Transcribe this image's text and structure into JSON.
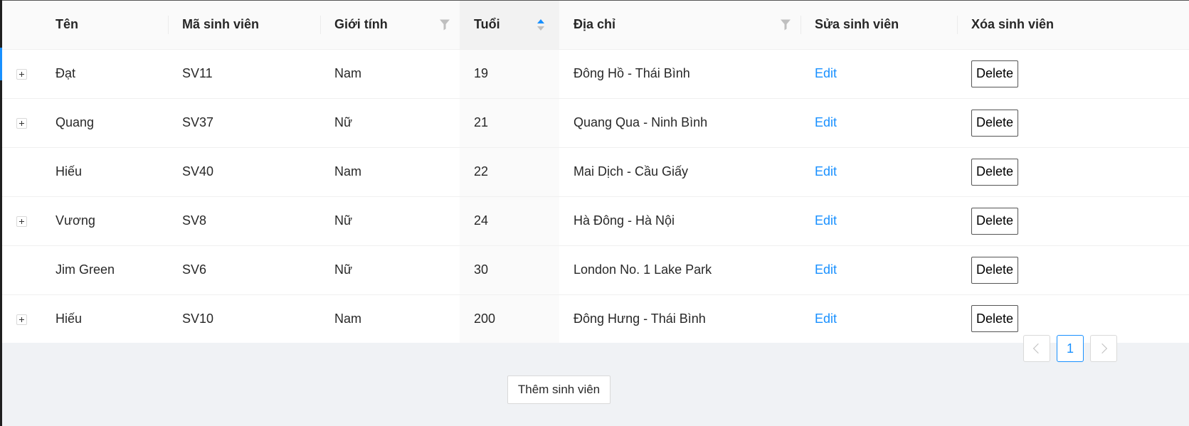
{
  "table": {
    "columns": {
      "name": "Tên",
      "student_id": "Mã sinh viên",
      "gender": "Giới tính",
      "age": "Tuổi",
      "address": "Địa chỉ",
      "edit": "Sửa sinh viên",
      "delete": "Xóa sinh viên"
    },
    "sorted_column": "age",
    "sort_order": "ascend",
    "filter_columns": [
      "gender",
      "address"
    ],
    "rows": [
      {
        "expandable": true,
        "name": "Đạt",
        "student_id": "SV11",
        "gender": "Nam",
        "age": "19",
        "address": "Đông Hồ - Thái Bình",
        "edit_label": "Edit",
        "delete_label": "Delete"
      },
      {
        "expandable": true,
        "name": "Quang",
        "student_id": "SV37",
        "gender": "Nữ",
        "age": "21",
        "address": "Quang Qua - Ninh Bình",
        "edit_label": "Edit",
        "delete_label": "Delete"
      },
      {
        "expandable": false,
        "name": "Hiếu",
        "student_id": "SV40",
        "gender": "Nam",
        "age": "22",
        "address": "Mai Dịch - Cầu Giấy",
        "edit_label": "Edit",
        "delete_label": "Delete"
      },
      {
        "expandable": true,
        "name": "Vương",
        "student_id": "SV8",
        "gender": "Nữ",
        "age": "24",
        "address": "Hà Đông - Hà Nội",
        "edit_label": "Edit",
        "delete_label": "Delete"
      },
      {
        "expandable": false,
        "name": "Jim Green",
        "student_id": "SV6",
        "gender": "Nữ",
        "age": "30",
        "address": "London No. 1 Lake Park",
        "edit_label": "Edit",
        "delete_label": "Delete"
      },
      {
        "expandable": true,
        "name": "Hiếu",
        "student_id": "SV10",
        "gender": "Nam",
        "age": "200",
        "address": "Đông Hưng - Thái Bình",
        "edit_label": "Edit",
        "delete_label": "Delete"
      }
    ]
  },
  "pagination": {
    "current_page": "1",
    "prev_icon": "chevron-left-icon",
    "next_icon": "chevron-right-icon"
  },
  "add_button_label": "Thêm sinh viên",
  "colors": {
    "accent": "#1890ff",
    "header_bg": "#fafafa",
    "page_bg": "#f0f2f5",
    "border": "#f0f0f0"
  }
}
